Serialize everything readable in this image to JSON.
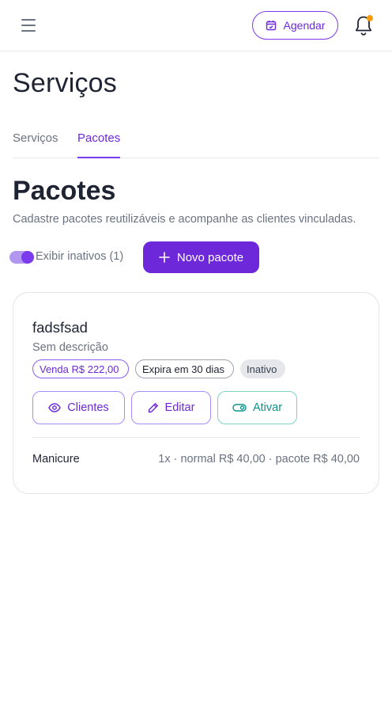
{
  "header": {
    "agendar_label": "Agendar",
    "icons": {
      "menu": "hamburger-icon",
      "calendar": "calendar-icon",
      "bell": "bell-icon"
    },
    "notification_dot_color": "#f59e0b"
  },
  "page": {
    "title": "Serviços"
  },
  "tabs": [
    {
      "label": "Serviços",
      "active": false
    },
    {
      "label": "Pacotes",
      "active": true
    }
  ],
  "section": {
    "title": "Pacotes",
    "subtitle": "Cadastre pacotes reutilizáveis e acompanhe as clientes vinculadas."
  },
  "filters": {
    "show_inactive_label": "Exibir inativos (1)",
    "show_inactive_on": true
  },
  "new_package_label": "Novo pacote",
  "package": {
    "name": "fadsfsad",
    "description": "Sem descrição",
    "badges": {
      "venda": "Venda R$ 222,00",
      "expira": "Expira em 30 dias",
      "status": "Inativo"
    },
    "actions": {
      "clientes": "Clientes",
      "editar": "Editar",
      "ativar": "Ativar"
    },
    "services": [
      {
        "name": "Manicure",
        "detail": "1x · normal R$ 40,00 · pacote R$ 40,00"
      }
    ]
  },
  "colors": {
    "accent": "#6d28d9",
    "accent_light": "#a78bfa",
    "teal": "#0d9488"
  }
}
